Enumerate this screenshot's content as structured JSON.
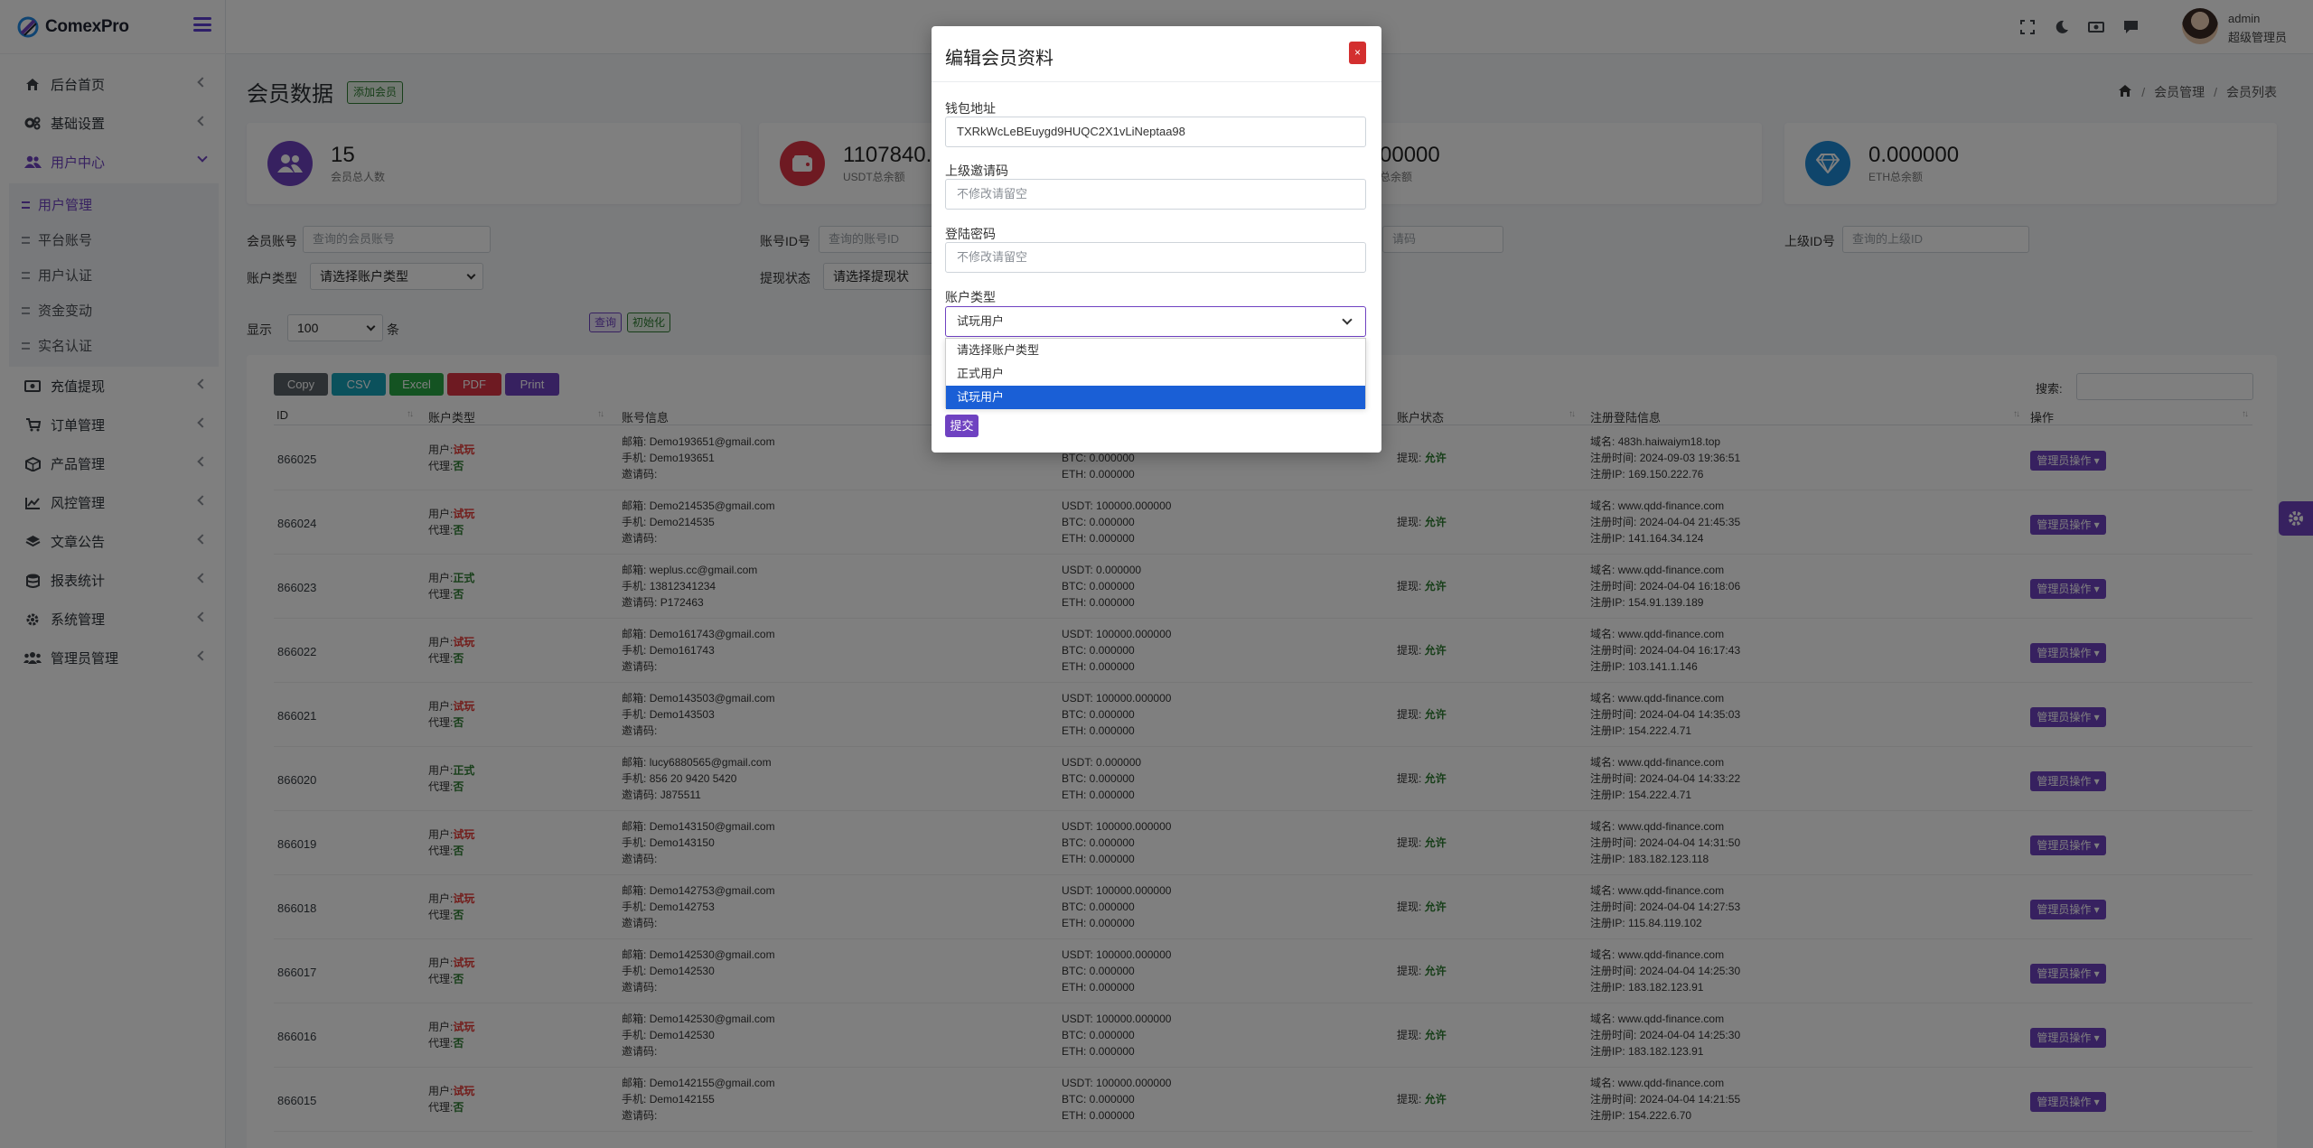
{
  "brand": {
    "name": "ComexPro"
  },
  "sidebar": {
    "items": [
      {
        "label": "后台首页",
        "icon": "home-icon"
      },
      {
        "label": "基础设置",
        "icon": "cogs-icon"
      },
      {
        "label": "用户中心",
        "icon": "users-icon",
        "active": true
      },
      {
        "label": "充值提现",
        "icon": "money-icon"
      },
      {
        "label": "订单管理",
        "icon": "cart-icon"
      },
      {
        "label": "产品管理",
        "icon": "box-icon"
      },
      {
        "label": "风控管理",
        "icon": "chart-icon"
      },
      {
        "label": "文章公告",
        "icon": "layers-icon"
      },
      {
        "label": "报表统计",
        "icon": "database-icon"
      },
      {
        "label": "系统管理",
        "icon": "gear-icon"
      },
      {
        "label": "管理员管理",
        "icon": "admins-icon"
      }
    ],
    "submenu": [
      "用户管理",
      "平台账号",
      "用户认证",
      "资金变动",
      "实名认证"
    ]
  },
  "topbar": {
    "user_name": "admin",
    "user_role": "超级管理员"
  },
  "page": {
    "title": "会员数据",
    "add_button": "添加会员",
    "breadcrumb": [
      "会员管理",
      "会员列表"
    ]
  },
  "stats": [
    {
      "value": "15",
      "label": "会员总人数",
      "color": "#6f42c1"
    },
    {
      "value": "1107840.0",
      "label": "USDT总余额",
      "color": "#dc3545"
    },
    {
      "value": "00000",
      "label": "总余额",
      "color": "#1f8ad6"
    },
    {
      "value": "0.000000",
      "label": "ETH总余额",
      "color": "#1f8ad6"
    }
  ],
  "filters": {
    "member_account_label": "会员账号",
    "member_account_ph": "查询的会员账号",
    "account_id_label": "账号ID号",
    "account_id_ph": "查询的账号ID",
    "invite_ph": "请码",
    "parent_id_label": "上级ID号",
    "parent_id_ph": "查询的上级ID",
    "account_type_label": "账户类型",
    "account_type_value": "请选择账户类型",
    "withdraw_label": "提现状态",
    "withdraw_value": "请选择提现状",
    "show_label": "显示",
    "show_value": "100",
    "show_unit": "条",
    "query_button": "查询",
    "reset_button": "初始化"
  },
  "export_buttons": [
    {
      "label": "Copy",
      "color": "#5a6268"
    },
    {
      "label": "CSV",
      "color": "#17a2b8"
    },
    {
      "label": "Excel",
      "color": "#28a745"
    },
    {
      "label": "PDF",
      "color": "#dc3545"
    },
    {
      "label": "Print",
      "color": "#6f42c1"
    }
  ],
  "table": {
    "search_label": "搜索:",
    "headers": [
      "ID",
      "账户类型",
      "账号信息",
      "账户状态",
      "注册登陆信息",
      "操作"
    ],
    "labels": {
      "user": "用户:",
      "agent": "代理:",
      "email": "邮箱:",
      "phone": "手机:",
      "invite": "邀请码:",
      "withdraw": "提现:",
      "domain": "域名:",
      "reg_time": "注册时间:",
      "reg_ip": "注册IP:"
    },
    "op_button": "管理员操作",
    "rows": [
      {
        "id": "866025",
        "type": "试玩",
        "agent": "否",
        "email": "Demo193651@gmail.com",
        "phone": "Demo193651",
        "invite": "",
        "usdt": "",
        "btc": "0.000000",
        "eth": "0.000000",
        "withdraw": "允许",
        "domain": "483h.haiwaiym18.top",
        "reg_time": "2024-09-03 19:36:51",
        "ip": "169.150.222.76"
      },
      {
        "id": "866024",
        "type": "试玩",
        "agent": "否",
        "email": "Demo214535@gmail.com",
        "phone": "Demo214535",
        "invite": "",
        "usdt": "100000.000000",
        "btc": "0.000000",
        "eth": "0.000000",
        "withdraw": "允许",
        "domain": "www.qdd-finance.com",
        "reg_time": "2024-04-04 21:45:35",
        "ip": "141.164.34.124"
      },
      {
        "id": "866023",
        "type": "正式",
        "agent": "否",
        "email": "weplus.cc@gmail.com",
        "phone": "13812341234",
        "invite": "P172463",
        "usdt": "0.000000",
        "btc": "0.000000",
        "eth": "0.000000",
        "withdraw": "允许",
        "domain": "www.qdd-finance.com",
        "reg_time": "2024-04-04 16:18:06",
        "ip": "154.91.139.189"
      },
      {
        "id": "866022",
        "type": "试玩",
        "agent": "否",
        "email": "Demo161743@gmail.com",
        "phone": "Demo161743",
        "invite": "",
        "usdt": "100000.000000",
        "btc": "0.000000",
        "eth": "0.000000",
        "withdraw": "允许",
        "domain": "www.qdd-finance.com",
        "reg_time": "2024-04-04 16:17:43",
        "ip": "103.141.1.146"
      },
      {
        "id": "866021",
        "type": "试玩",
        "agent": "否",
        "email": "Demo143503@gmail.com",
        "phone": "Demo143503",
        "invite": "",
        "usdt": "100000.000000",
        "btc": "0.000000",
        "eth": "0.000000",
        "withdraw": "允许",
        "domain": "www.qdd-finance.com",
        "reg_time": "2024-04-04 14:35:03",
        "ip": "154.222.4.71"
      },
      {
        "id": "866020",
        "type": "正式",
        "agent": "否",
        "email": "lucy6880565@gmail.com",
        "phone": "856 20 9420 5420",
        "invite": "J875511",
        "usdt": "0.000000",
        "btc": "0.000000",
        "eth": "0.000000",
        "withdraw": "允许",
        "domain": "www.qdd-finance.com",
        "reg_time": "2024-04-04 14:33:22",
        "ip": "154.222.4.71"
      },
      {
        "id": "866019",
        "type": "试玩",
        "agent": "否",
        "email": "Demo143150@gmail.com",
        "phone": "Demo143150",
        "invite": "",
        "usdt": "100000.000000",
        "btc": "0.000000",
        "eth": "0.000000",
        "withdraw": "允许",
        "domain": "www.qdd-finance.com",
        "reg_time": "2024-04-04 14:31:50",
        "ip": "183.182.123.118"
      },
      {
        "id": "866018",
        "type": "试玩",
        "agent": "否",
        "email": "Demo142753@gmail.com",
        "phone": "Demo142753",
        "invite": "",
        "usdt": "100000.000000",
        "btc": "0.000000",
        "eth": "0.000000",
        "withdraw": "允许",
        "domain": "www.qdd-finance.com",
        "reg_time": "2024-04-04 14:27:53",
        "ip": "115.84.119.102"
      },
      {
        "id": "866017",
        "type": "试玩",
        "agent": "否",
        "email": "Demo142530@gmail.com",
        "phone": "Demo142530",
        "invite": "",
        "usdt": "100000.000000",
        "btc": "0.000000",
        "eth": "0.000000",
        "withdraw": "允许",
        "domain": "www.qdd-finance.com",
        "reg_time": "2024-04-04 14:25:30",
        "ip": "183.182.123.91"
      },
      {
        "id": "866016",
        "type": "试玩",
        "agent": "否",
        "email": "Demo142530@gmail.com",
        "phone": "Demo142530",
        "invite": "",
        "usdt": "100000.000000",
        "btc": "0.000000",
        "eth": "0.000000",
        "withdraw": "允许",
        "domain": "www.qdd-finance.com",
        "reg_time": "2024-04-04 14:25:30",
        "ip": "183.182.123.91"
      },
      {
        "id": "866015",
        "type": "试玩",
        "agent": "否",
        "email": "Demo142155@gmail.com",
        "phone": "Demo142155",
        "invite": "",
        "usdt": "100000.000000",
        "btc": "0.000000",
        "eth": "0.000000",
        "withdraw": "允许",
        "domain": "www.qdd-finance.com",
        "reg_time": "2024-04-04 14:21:55",
        "ip": "154.222.6.70"
      }
    ]
  },
  "modal": {
    "title": "编辑会员资料",
    "close": "×",
    "wallet_label": "钱包地址",
    "wallet_value": "TXRkWcLeBEuygd9HUQC2X1vLiNeptaa98",
    "parent_invite_label": "上级邀请码",
    "parent_invite_ph": "不修改请留空",
    "password_label": "登陆密码",
    "password_ph": "不修改请留空",
    "account_type_label": "账户类型",
    "account_type_value": "试玩用户",
    "options": [
      "请选择账户类型",
      "正式用户",
      "试玩用户"
    ],
    "selected_option": 2,
    "submit": "提交"
  },
  "colors": {
    "accent": "#6f42c1",
    "danger": "#e53935",
    "success": "#2e7d32",
    "select_highlight": "#1a5fd6"
  }
}
